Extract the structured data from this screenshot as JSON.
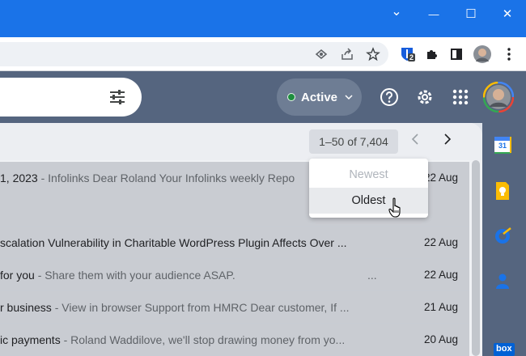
{
  "window": {
    "minimize_glyph": "—",
    "maximize_glyph": "☐",
    "close_glyph": "✕",
    "dropdown_glyph": "⌄"
  },
  "toolbar": {
    "icons": [
      "eye-icon",
      "share-icon",
      "star-icon",
      "bitwarden-extension-icon",
      "extensions-icon",
      "sidepanel-icon",
      "profile-avatar",
      "more-menu-icon"
    ],
    "extension_badge": "2"
  },
  "header": {
    "status_label": "Active",
    "status_color": "#1e8e3e",
    "icons": [
      "filter-icon",
      "help-icon",
      "settings-icon",
      "apps-grid-icon",
      "account-avatar"
    ]
  },
  "list": {
    "page_count": "1–50 of 7,404",
    "prev_glyph": "‹",
    "next_glyph": "›",
    "rows": [
      {
        "subject": "1, 2023",
        "snippet": " - Infolinks Dear Roland Your Infolinks weekly Repo",
        "date": "22 Aug"
      },
      {
        "subject": "scalation Vulnerability in Charitable WordPress Plugin Affects Over ...",
        "snippet": "",
        "date": "22 Aug"
      },
      {
        "subject": "for you",
        "snippet": " - Share them with your audience ASAP.",
        "ellipsis": "...",
        "date": "22 Aug"
      },
      {
        "subject": "r business",
        "snippet": " - View in browser Support from HMRC Dear customer, If ...",
        "date": "21 Aug"
      },
      {
        "subject": "ic payments",
        "snippet": " - Roland Waddilove, we'll stop drawing money from yo...",
        "date": "20 Aug"
      }
    ]
  },
  "sort_menu": {
    "newest": "Newest",
    "oldest": "Oldest"
  },
  "side_panel": {
    "apps": [
      "calendar-icon",
      "keep-icon",
      "tasks-icon",
      "contacts-icon",
      "box-icon"
    ],
    "calendar_day": "31",
    "box_label": "box"
  },
  "colors": {
    "chrome_blue": "#1a73e8",
    "gmail_header": "#55657f",
    "menu_highlight": "#e8eaed"
  }
}
